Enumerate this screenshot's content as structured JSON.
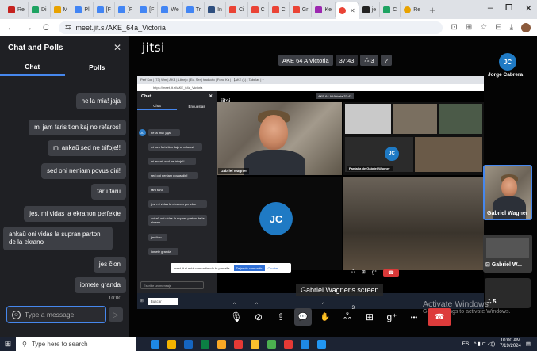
{
  "browser": {
    "tabs": [
      {
        "label": "Re",
        "color": "#c5221f"
      },
      {
        "label": "Di",
        "color": "#1ea362"
      },
      {
        "label": "M",
        "color": "#e8a200"
      },
      {
        "label": "Pl",
        "color": "#4285f4"
      },
      {
        "label": "[F",
        "color": "#4285f4"
      },
      {
        "label": "[F",
        "color": "#4285f4"
      },
      {
        "label": "[F",
        "color": "#4285f4"
      },
      {
        "label": "We",
        "color": "#4285f4"
      },
      {
        "label": "Tr",
        "color": "#4285f4"
      },
      {
        "label": "In",
        "color": "#2f4f7f"
      },
      {
        "label": "Ci",
        "color": "#ea4335"
      },
      {
        "label": "C",
        "color": "#ea4335"
      },
      {
        "label": "C",
        "color": "#ea4335"
      },
      {
        "label": "Gr",
        "color": "#ea4335"
      },
      {
        "label": "Ke",
        "color": "#9c27b0"
      },
      {
        "label": "je",
        "color": "#222222"
      },
      {
        "label": "C",
        "color": "#1ea362"
      }
    ],
    "active_tab_color": "#ea4335",
    "extra_tab": {
      "label": "Re",
      "color": "#e8a200"
    },
    "new_tab": "+",
    "win_minimize": "–",
    "win_maximize": "⧠",
    "win_close": "✕",
    "back": "←",
    "forward": "→",
    "reload": "C",
    "url": "meet.jit.si/AKE_64a_Victoria",
    "tune_icon": "⇆",
    "right_icons": [
      "⊡",
      "⊞",
      "☆",
      "⊟",
      "⤓"
    ]
  },
  "chat": {
    "title": "Chat and Polls",
    "close": "✕",
    "tabs": [
      "Chat",
      "Polls"
    ],
    "messages": [
      {
        "text": "ne la mia! jaja",
        "side": "right"
      },
      {
        "text": "mi jam faris tion kaj no refaros!",
        "side": "right"
      },
      {
        "text": "mi ankaŭ sed ne trifoje!!",
        "side": "right"
      },
      {
        "text": "sed oni neniam povus diri!",
        "side": "right"
      },
      {
        "text": "faru faru",
        "side": "right"
      },
      {
        "text": "jes, mi vidas la ekranon perfekte",
        "side": "right"
      },
      {
        "text": "ankaŭ oni vidas la supran parton de la ekrano",
        "side": "left"
      },
      {
        "text": "jes ĉion",
        "side": "right"
      },
      {
        "text": "iomete granda",
        "side": "right"
      }
    ],
    "last_time": "10:00",
    "input_placeholder": "Type a message",
    "send_icon": "▷"
  },
  "meeting": {
    "logo": "jitsi",
    "room_name": "AKE 64 A Victoria",
    "timer": "37:43",
    "participants": "3",
    "participants_icon": "ஃ",
    "help_icon": "?",
    "screen_caption": "Gabriel Wagner's screen"
  },
  "shared": {
    "tabs_text": "Perf Kor | (73) Wm | AKE | Librejo | Ec. Ser | traducto | Fono Ka | 【AKE (1) | Tabelas | +",
    "url": "https://meet.jit.si/AKE_64a_Victoria",
    "chat_title": "Chat",
    "chat_tabs": [
      "Chat",
      "Encuestas"
    ],
    "avatar": "JC",
    "messages": [
      "ne la mia! jaja",
      "mi jam faris tion kaj no refaros!",
      "mi ankaŭ sed ne trifoje!!",
      "sed oni neniam povus diri!",
      "faru faru",
      "jes, mi vidas la ekranon perfekte",
      "ankaŭ oni vidas la supran parton de la ekrano",
      "jes ĉion",
      "iomete granda"
    ],
    "input_placeholder": "Escribe un mensaje",
    "logo": "jitsi",
    "pill": "AKE 64 A Victoria  37:43",
    "gabriel_name": "Gabriel Wagner",
    "screen_label": "Pantalla de Gabriel Wagner",
    "jc_initials": "JC",
    "jorge_name": "Jorge Cabrera",
    "notify_text": "meet.jit.si está compartiendo tu pantalla.",
    "notify_btn1": "Dejar de compartir",
    "notify_btn2": "Ocultar",
    "taskbar_search": "Buscar",
    "toolbar_icons": [
      "ஃ",
      "⊞",
      "g⁺"
    ],
    "hangup_icon": "☎"
  },
  "filmstrip": {
    "jorge": {
      "initials": "JC",
      "name": "Jorge Cabrera",
      "color": "#1f7ac4"
    },
    "gabriel": {
      "name": "Gabriel Wagner"
    },
    "gabriel_screen": {
      "name": "Gabriel W...",
      "icon": "⊡"
    },
    "count_badge": "5",
    "count_icon": "ஃ"
  },
  "toolbar": {
    "mic": "🎙",
    "camera": "⊘",
    "share": "⇪",
    "chat": "💬",
    "raise_hand": "✋",
    "participants": "ஃ",
    "participants_count": "3",
    "tile_view": "⊞",
    "invite": "g⁺",
    "more": "•••",
    "hangup": "☎",
    "caret": "^"
  },
  "watermark": {
    "title": "Activate Windows",
    "subtitle": "Go to Settings to activate Windows."
  },
  "taskbar": {
    "start": "⊞",
    "search_icon": "⚲",
    "search_placeholder": "Type here to search",
    "apps": [
      "#1e88e5",
      "#f4b400",
      "#1565c0",
      "#0b8043",
      "#f9a825",
      "#e53935",
      "#fbc02d",
      "#4caf50",
      "#e53935",
      "#1e88e5",
      "#2196f3"
    ],
    "lang": "ES",
    "tray_icons": "^ ▮ ⊏ ◁))",
    "time": "10:00 AM",
    "date": "7/19/2024",
    "notif_icon": "▤"
  }
}
